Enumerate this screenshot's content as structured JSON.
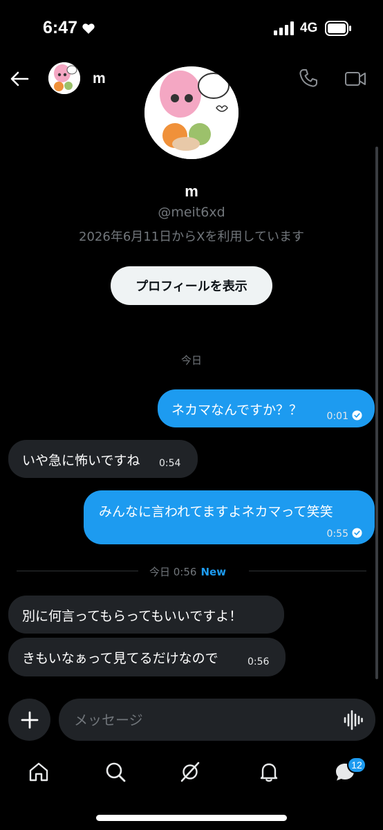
{
  "status_bar": {
    "time": "6:47",
    "network": "4G",
    "heart_icon": "heart-icon",
    "signal_icon": "cellular-signal-icon",
    "battery_icon": "battery-icon"
  },
  "header": {
    "back_icon": "arrow-left-icon",
    "name": "m",
    "phone_icon": "phone-icon",
    "video_icon": "video-camera-icon"
  },
  "profile": {
    "name": "m",
    "handle": "@meit6xd",
    "joined": "2026年6月11日からXを利用しています",
    "view_profile_label": "プロフィールを表示"
  },
  "conversation": {
    "date_separator": "今日",
    "messages": [
      {
        "direction": "outgoing",
        "text": "ネカマなんですか？？",
        "time": "0:01",
        "read": true
      },
      {
        "direction": "incoming",
        "text": "いや急に怖いですね",
        "time": "0:54"
      },
      {
        "direction": "outgoing",
        "text": "みんなに言われてますよネカマって笑笑",
        "time": "0:55",
        "read": true
      },
      {
        "direction": "incoming",
        "text": "別に何言ってもらってもいいですよ！",
        "time": ""
      },
      {
        "direction": "incoming",
        "text": "きもいなぁって見てるだけなので",
        "time": "0:56"
      }
    ],
    "new_separator": {
      "label": "今日 0:56",
      "new_label": "New"
    }
  },
  "composer": {
    "placeholder": "メッセージ",
    "add_icon": "plus-icon",
    "voice_icon": "voice-waveform-icon"
  },
  "bottom_nav": {
    "items": [
      "home-icon",
      "search-icon",
      "grok-icon",
      "bell-icon",
      "messages-icon"
    ],
    "messages_badge": "12"
  },
  "colors": {
    "accent": "#1d9bf0",
    "background": "#000000",
    "incoming_bubble": "#202327",
    "muted_text": "#71767b"
  }
}
